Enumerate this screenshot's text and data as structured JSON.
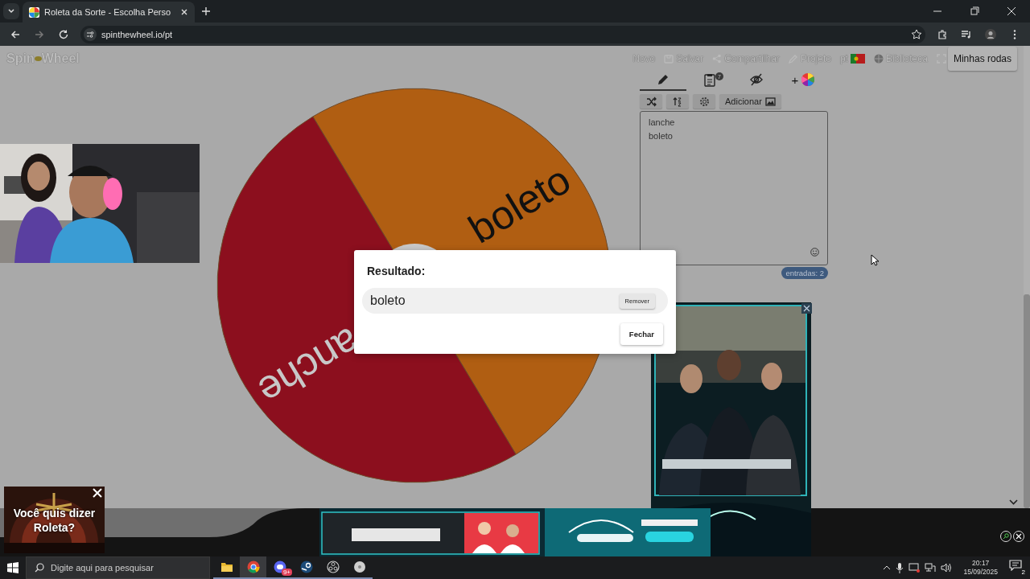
{
  "browser": {
    "tabs": [
      {
        "title": "Roleta da Sorte - Escolha Perso",
        "selected": true
      }
    ],
    "url": "spinthewheel.io/pt"
  },
  "site": {
    "logo": [
      "Spin",
      "Wheel"
    ],
    "nav": [
      {
        "kind": "text",
        "label": "Novo"
      },
      {
        "kind": "save",
        "label": "Salvar"
      },
      {
        "kind": "share",
        "label": "Compartilhar"
      },
      {
        "kind": "edit",
        "label": "Projeto"
      },
      {
        "kind": "language",
        "label": "pt"
      },
      {
        "kind": "library",
        "label": "Biblioteca"
      },
      {
        "kind": "fullscreen"
      }
    ],
    "account_button": "Minhas rodas"
  },
  "editor": {
    "tabs": [
      {
        "kind": "edit",
        "selected": true
      },
      {
        "kind": "results",
        "selected": false,
        "badge": "7"
      },
      {
        "kind": "hide",
        "selected": false
      },
      {
        "kind": "colors",
        "label": "+",
        "selected": false
      }
    ],
    "tools": [
      {
        "kind": "shuffle"
      },
      {
        "kind": "sort"
      },
      {
        "kind": "settings"
      },
      {
        "kind": "add",
        "label": "Adicionar"
      }
    ],
    "entries": [
      "lanche",
      "boleto"
    ],
    "count": "entradas: 2"
  },
  "wheel": {
    "segments": [
      {
        "label": "boleto",
        "color": "#b05e12"
      },
      {
        "label": "anche",
        "color": "#8c0f1e"
      }
    ]
  },
  "dialog": {
    "title": "Resultado:",
    "result": "boleto",
    "remove": "Remover",
    "close": "Fechar"
  },
  "popup_ad": {
    "text": "Você quis dizer Roleta?"
  },
  "taskbar": {
    "search_placeholder": "Digite aqui para pesquisar",
    "apps": [
      {
        "kind": "folder",
        "selected": false
      },
      {
        "kind": "browser",
        "selected": true
      },
      {
        "kind": "chat",
        "selected": false,
        "badge": "9+"
      },
      {
        "kind": "steam",
        "selected": false
      },
      {
        "kind": "record",
        "selected": false
      },
      {
        "kind": "disc",
        "selected": false
      }
    ],
    "time": "20:17",
    "date": "15/09/2025",
    "notifications": "2"
  }
}
